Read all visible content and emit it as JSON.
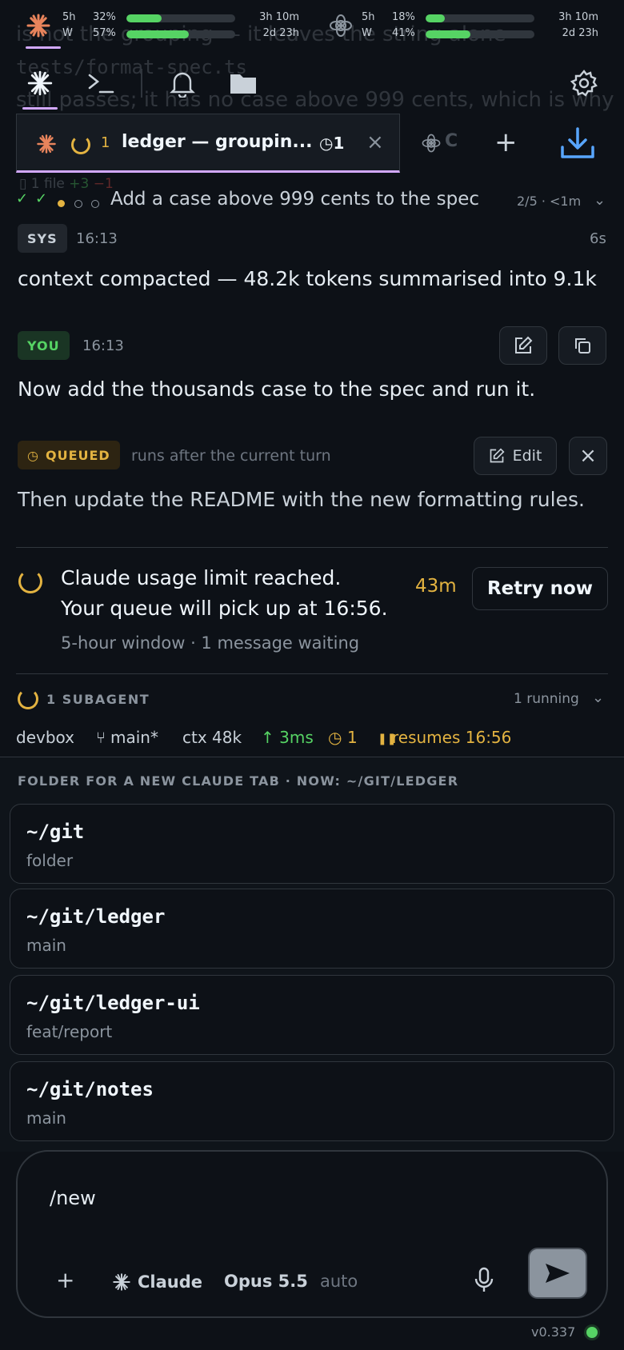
{
  "usage": [
    {
      "provider_icon": "claude-burst-icon",
      "rows": [
        {
          "label": "5h",
          "pct": "32%",
          "fill": 0.32,
          "time": "3h 10m"
        },
        {
          "label": "W",
          "pct": "57%",
          "fill": 0.57,
          "time": "2d 23h"
        }
      ]
    },
    {
      "provider_icon": "openai-knot-icon",
      "rows": [
        {
          "label": "5h",
          "pct": "18%",
          "fill": 0.18,
          "time": "3h 10m"
        },
        {
          "label": "W",
          "pct": "41%",
          "fill": 0.41,
          "time": "2d 23h"
        }
      ]
    }
  ],
  "background_text": {
    "line1": "is not the grouping — it leaves the string alone",
    "line2": "tests/format-spec.ts",
    "line3": "still passes; it has no case above 999 cents, which is why"
  },
  "tab": {
    "count": "1",
    "title": "ledger — groupin...",
    "queue": "1",
    "second_initial": "C"
  },
  "files": {
    "label": "1 file",
    "added": "+3",
    "removed": "−1"
  },
  "task": {
    "title": "Add a case above 999 cents to the spec",
    "progress": "2/5 · <1m"
  },
  "sys_msg": {
    "badge": "SYS",
    "time": "16:13",
    "duration": "6s",
    "text": "context compacted — 48.2k tokens summarised into 9.1k"
  },
  "user_msg": {
    "badge": "YOU",
    "time": "16:13",
    "text": "Now add the thousands case to the spec and run it."
  },
  "queued_msg": {
    "badge": "QUEUED",
    "hint": "runs after the current turn",
    "edit_label": "Edit",
    "text": "Then update the README with the new formatting rules."
  },
  "limit": {
    "line1": "Claude usage limit reached.",
    "line2": "Your queue will pick up at 16:56.",
    "countdown": "43m",
    "retry_label": "Retry now",
    "sub": "5-hour window · 1 message waiting"
  },
  "subagent": {
    "label": "1 SUBAGENT",
    "status": "1 running"
  },
  "statusbar": {
    "host": "devbox",
    "branch": "main*",
    "ctx": "ctx 48k",
    "latency": "↑ 3ms",
    "queue": "1",
    "resumes": "resumes 16:56"
  },
  "picker": {
    "heading": "FOLDER FOR A NEW CLAUDE TAB · NOW: ~/GIT/LEDGER",
    "items": [
      {
        "path": "~/git",
        "sub": "folder"
      },
      {
        "path": "~/git/ledger",
        "sub": "main"
      },
      {
        "path": "~/git/ledger-ui",
        "sub": "feat/report"
      },
      {
        "path": "~/git/notes",
        "sub": "main"
      }
    ]
  },
  "composer": {
    "value": "/new",
    "agent": "Claude",
    "model": "Opus 5.5",
    "mode": "auto"
  },
  "version": "v0.337",
  "colors": {
    "accent_claude": "#e8845c",
    "accent_purple": "#d2a8ff",
    "green": "#56d364",
    "amber": "#e3b341",
    "blue": "#58a6ff"
  }
}
